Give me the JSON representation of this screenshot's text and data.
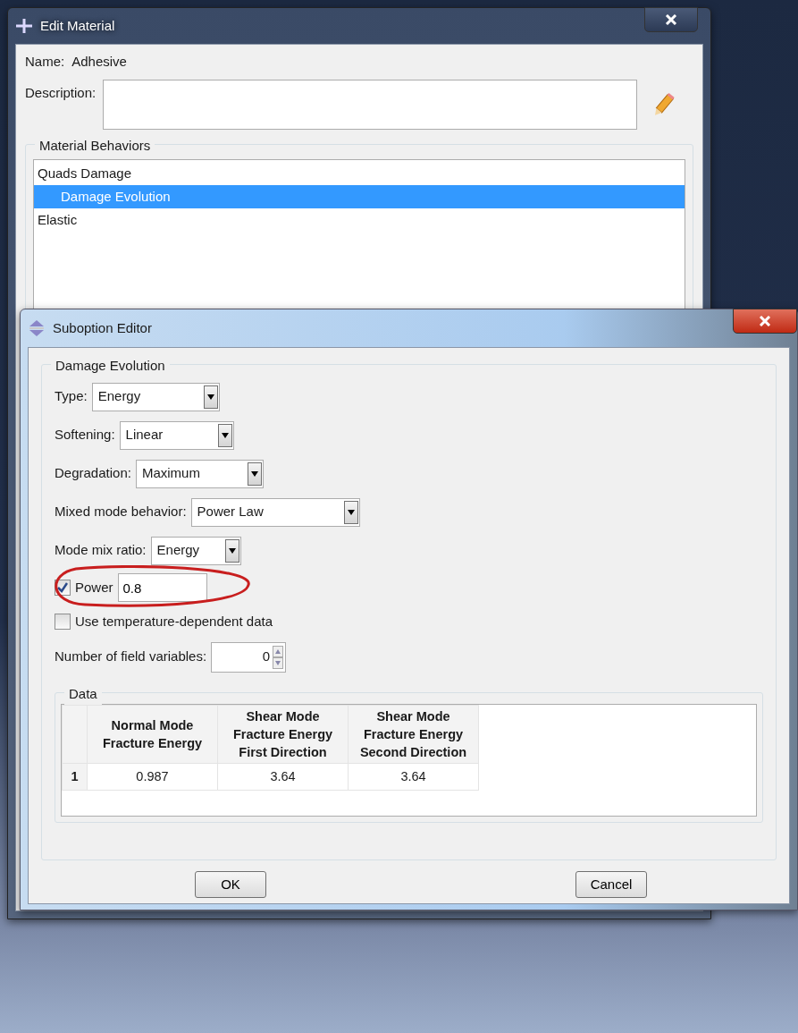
{
  "edit_material": {
    "title": "Edit Material",
    "name_label": "Name:",
    "name_value": "Adhesive",
    "description_label": "Description:",
    "behaviors_title": "Material Behaviors",
    "behaviors": [
      {
        "label": "Quads Damage",
        "selected": false,
        "children": [
          {
            "label": "Damage Evolution",
            "selected": true
          }
        ]
      },
      {
        "label": "Elastic",
        "selected": false
      }
    ]
  },
  "suboption_editor": {
    "title": "Suboption Editor",
    "group_title": "Damage Evolution",
    "dropdowns": [
      {
        "label": "Type:",
        "value": "Energy"
      },
      {
        "label": "Softening:",
        "value": "Linear"
      },
      {
        "label": "Degradation:",
        "value": "Maximum"
      },
      {
        "label": "Mixed mode behavior:",
        "value": "Power Law"
      },
      {
        "label": "Mode mix ratio:",
        "value": "Energy"
      }
    ],
    "power": {
      "label": "Power",
      "checked": true,
      "value": "0.8",
      "highlighted": true
    },
    "temperature": {
      "label": "Use temperature-dependent data",
      "checked": false
    },
    "field_variables": {
      "label": "Number of field variables:",
      "value": "0"
    },
    "data_title": "Data",
    "table": {
      "columns": [
        "Normal Mode\nFracture Energy",
        "Shear Mode\nFracture Energy\nFirst Direction",
        "Shear Mode\nFracture Energy\nSecond Direction"
      ],
      "rows": [
        {
          "index": "1",
          "cells": [
            "0.987",
            "3.64",
            "3.64"
          ]
        }
      ]
    },
    "buttons": [
      "OK",
      "Cancel"
    ]
  }
}
